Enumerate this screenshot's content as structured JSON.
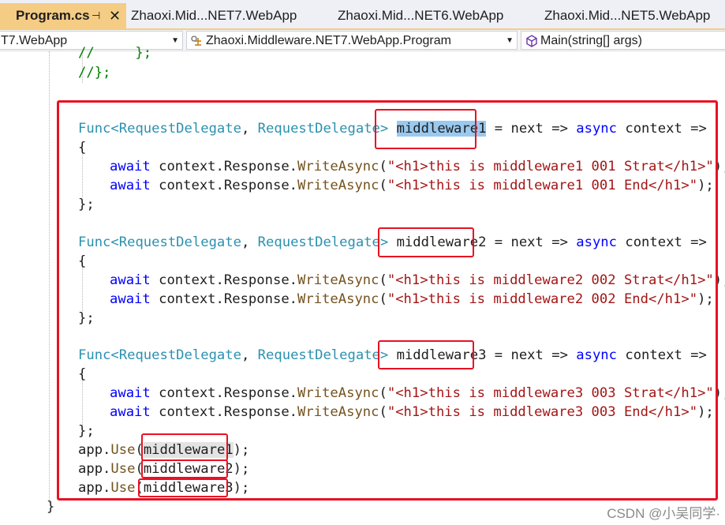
{
  "tabs": [
    {
      "label": "Program.cs",
      "pin": "⊣",
      "close": "✕"
    },
    {
      "label": "Zhaoxi.Mid...NET7.WebApp"
    },
    {
      "label": "Zhaoxi.Mid...NET6.WebApp"
    },
    {
      "label": "Zhaoxi.Mid...NET5.WebApp"
    }
  ],
  "nav": {
    "project": "T7.WebApp",
    "class": "Zhaoxi.Middleware.NET7.WebApp.Program",
    "member": "Main(string[] args)"
  },
  "code": {
    "c1": "//     };",
    "c2": "//};",
    "m1_name": "middleware1",
    "m2_name": "middleware2",
    "m3_name": "middleware3",
    "func_open": "Func<",
    "request_delegate": "RequestDelegate",
    "comma": ", ",
    "gt": ">",
    "arrow_part": " = next => ",
    "async": "async",
    "context_arrow": " context =>",
    "brace_open": "{",
    "brace_close": "};",
    "await": "await",
    "context_response": " context.Response.",
    "write_async": "WriteAsync",
    "paren_open": "(",
    "paren_close_semi": ");",
    "s_m1_start": "\"<h1>this is middleware1 001 Strat</h1>\"",
    "s_m1_end": "\"<h1>this is middleware1 001 End</h1>\"",
    "s_m2_start": "\"<h1>this is middleware2 002 Strat</h1>\"",
    "s_m2_end": "\"<h1>this is middleware2 002 End</h1>\"",
    "s_m3_start": "\"<h1>this is middleware3 003 Strat</h1>\"",
    "s_m3_end": "\"<h1>this is middleware3 003 End</h1>\"",
    "app": "app.",
    "use": "Use",
    "use_close": ");",
    "outer_close": "}"
  },
  "watermark": "CSDN @小吴同学·"
}
